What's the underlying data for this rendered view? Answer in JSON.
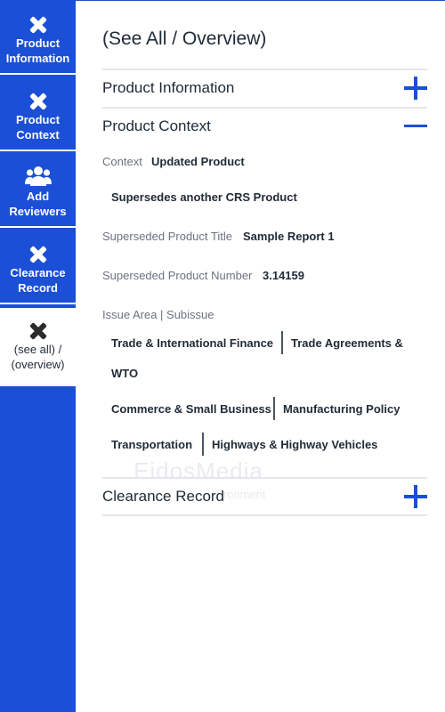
{
  "sidebar": {
    "items": [
      {
        "label": "Product Information",
        "icon": "close-icon"
      },
      {
        "label": "Product Context",
        "icon": "close-icon"
      },
      {
        "label": "Add Reviewers",
        "icon": "users-icon"
      },
      {
        "label": "Clearance Record",
        "icon": "close-icon"
      },
      {
        "label": "(see all) / (overview)",
        "icon": "close-icon",
        "active": true
      }
    ]
  },
  "main": {
    "title": "(See All / Overview)",
    "sections": {
      "product_information": "Product Information",
      "product_context": "Product Context",
      "clearance_record": "Clearance Record"
    },
    "context": {
      "context_label": "Context",
      "context_value": "Updated Product",
      "supersedes": "Supersedes another CRS Product",
      "superseded_title_label": "Superseded Product Title",
      "superseded_title_value": "Sample Report 1",
      "superseded_number_label": "Superseded Product Number",
      "superseded_number_value": "3.14159",
      "issue_area_label": "Issue Area | Subissue",
      "issue_rows": [
        {
          "area": "Trade & International Finance",
          "subissue_line1": "Trade Agreements &",
          "subissue_line2": "WTO"
        },
        {
          "area": "Commerce & Small Business",
          "subissue": "Manufacturing Policy"
        },
        {
          "area": "Transportation",
          "subissue": "Highways & Highway Vehicles"
        }
      ]
    },
    "watermark": {
      "brand": "EidosMedia",
      "sub": "ironment"
    }
  },
  "colors": {
    "accent": "#1a4fd6",
    "border": "#e3e6ea"
  }
}
